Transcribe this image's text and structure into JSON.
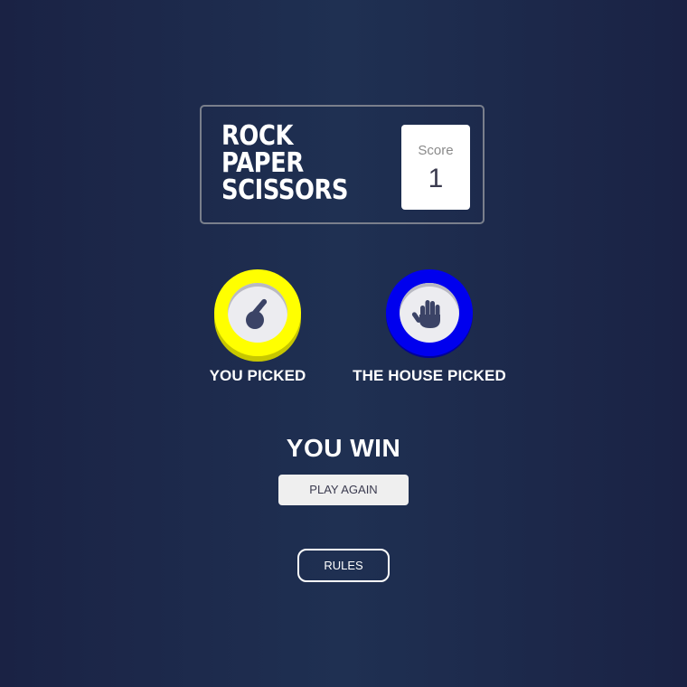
{
  "header": {
    "title_lines": [
      "ROCK",
      "PAPER",
      "SCISSORS"
    ],
    "score_label": "Score",
    "score_value": "1"
  },
  "player": {
    "label": "YOU PICKED",
    "choice_icon": "scissors-hand-icon",
    "ring_color": "#ffff00"
  },
  "house": {
    "label": "THE HOUSE PICKED",
    "choice_icon": "paper-hand-icon",
    "ring_color": "#0000ee"
  },
  "result": {
    "text": "YOU WIN",
    "play_again_label": "PLAY AGAIN"
  },
  "rules_label": "RULES",
  "colors": {
    "background": "#1f3052",
    "icon": "#3b4366"
  }
}
